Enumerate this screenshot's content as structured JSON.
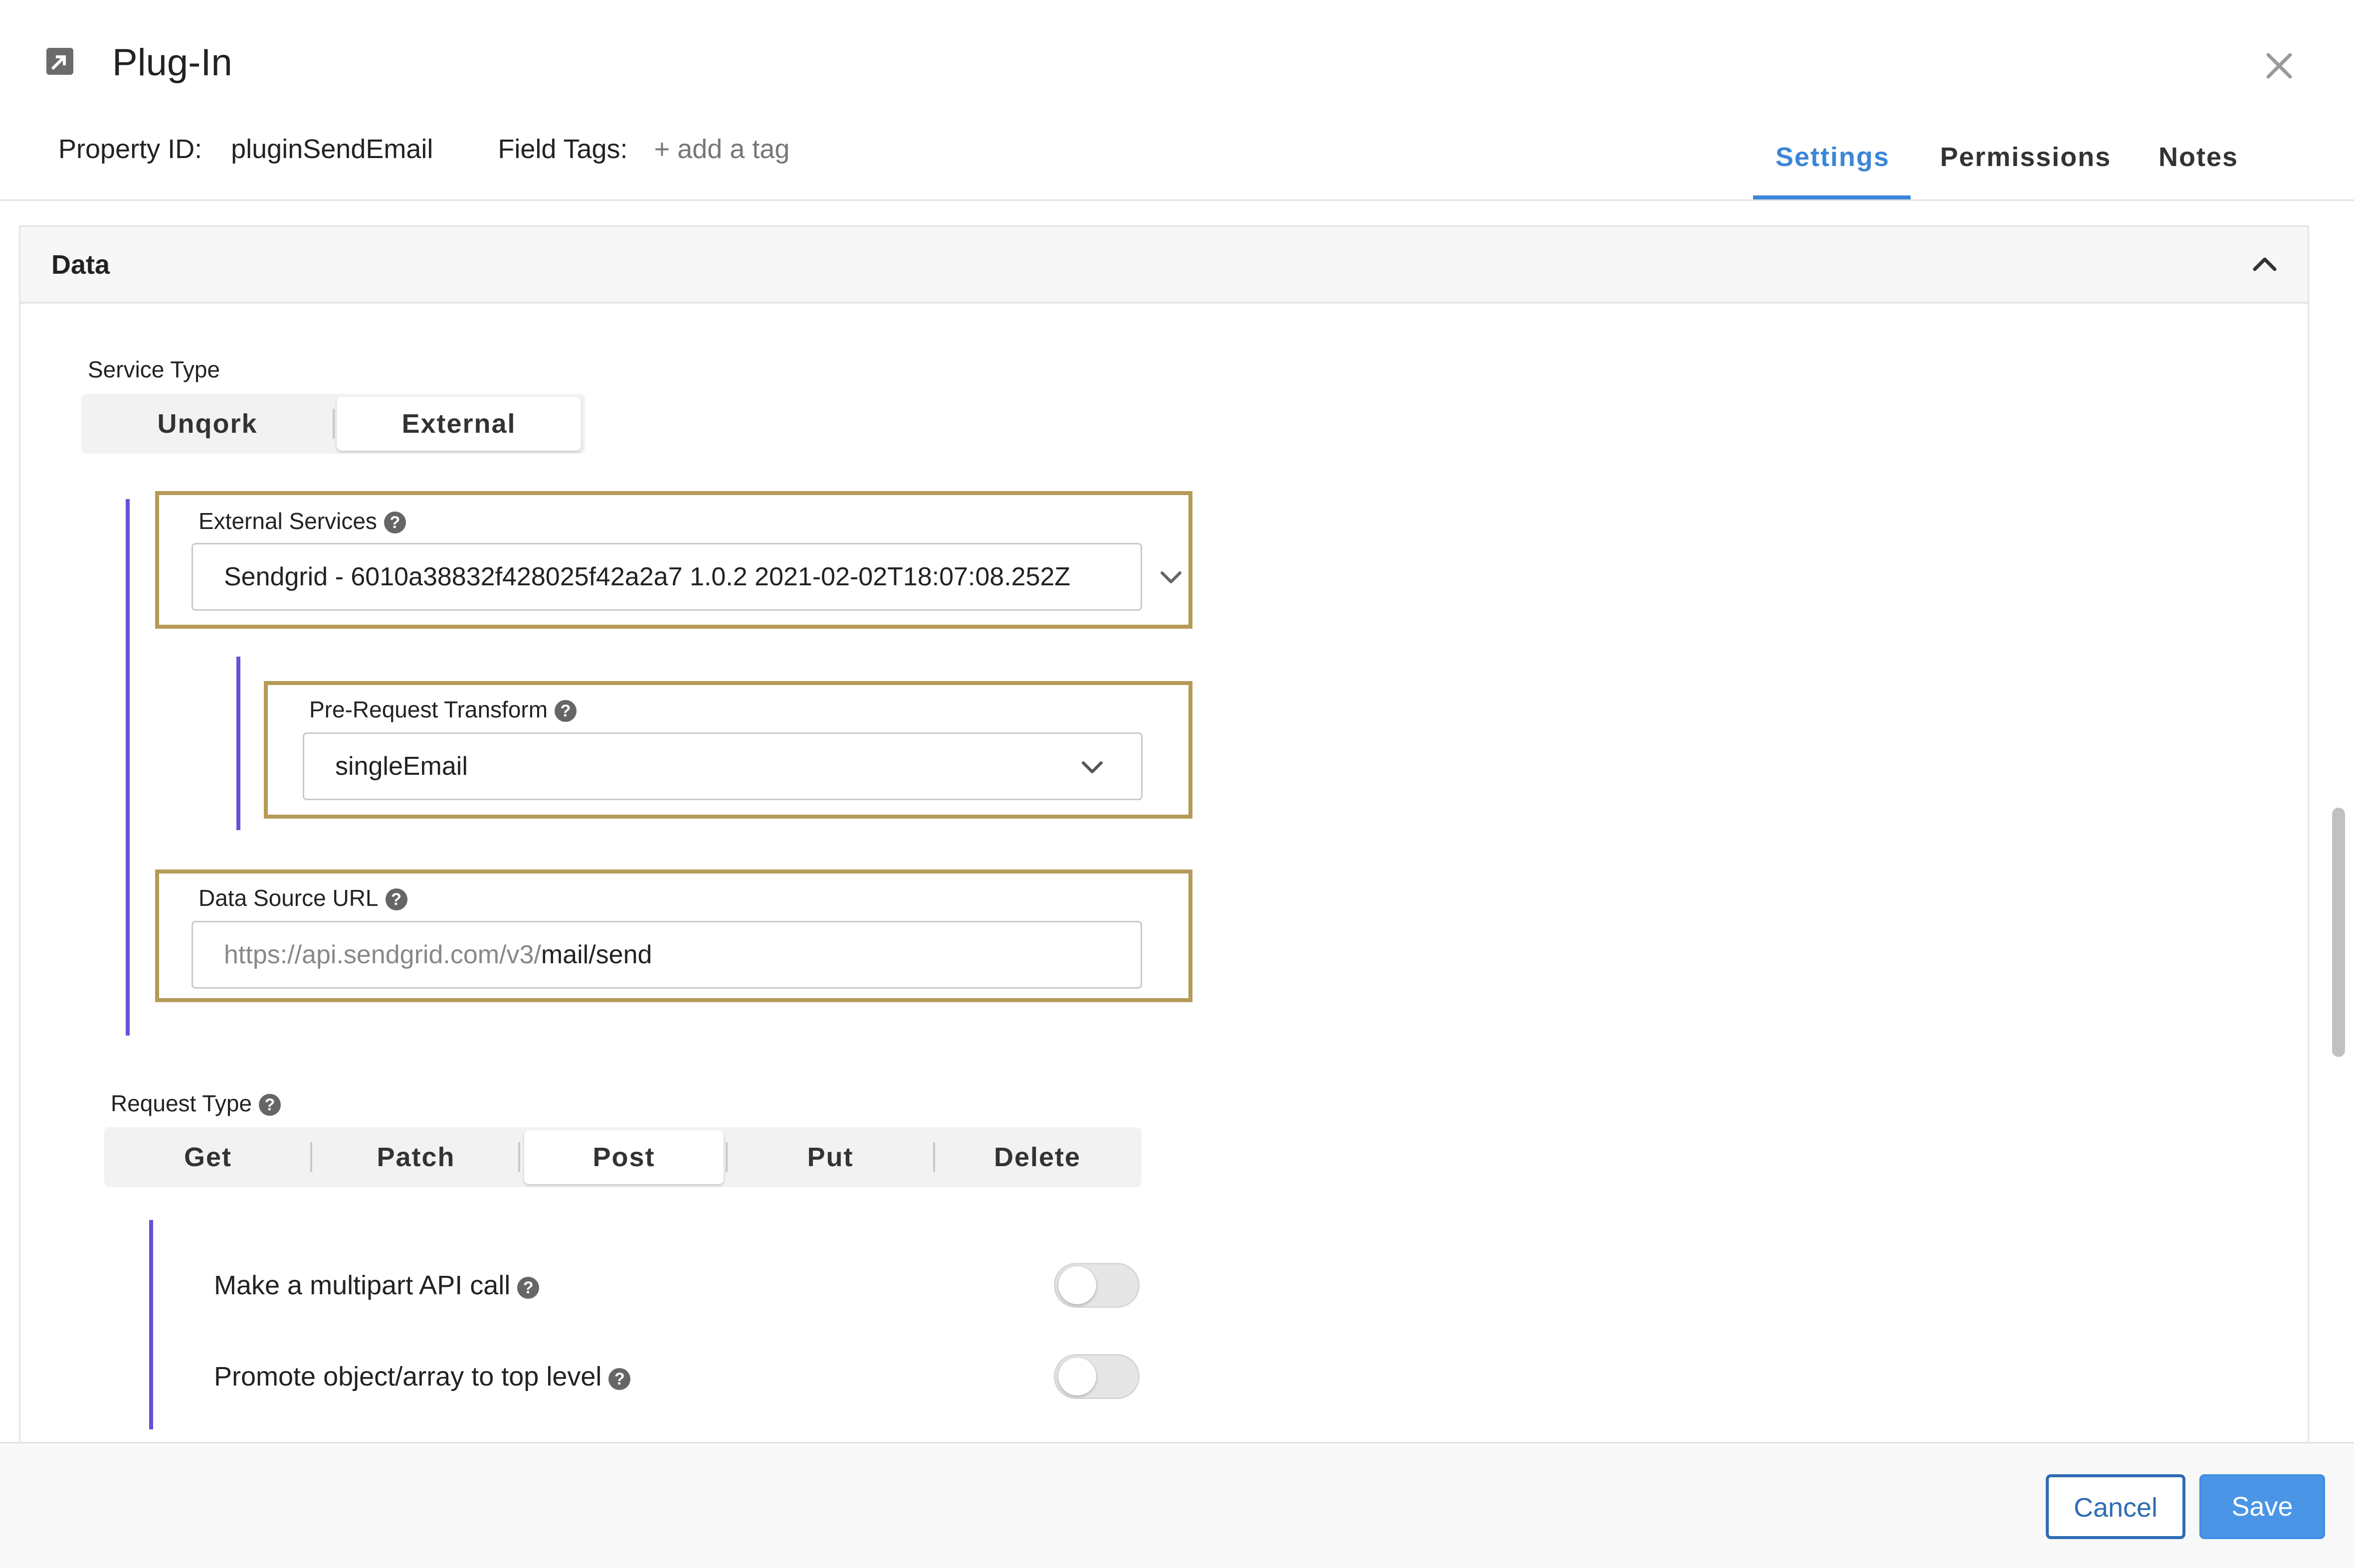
{
  "header": {
    "title": "Plug-In",
    "property_id_label": "Property ID:",
    "property_id_value": "pluginSendEmail",
    "field_tags_label": "Field Tags:",
    "add_tag": "+ add a tag",
    "tabs": [
      {
        "label": "Settings",
        "active": true
      },
      {
        "label": "Permissions",
        "active": false
      },
      {
        "label": "Notes",
        "active": false
      }
    ]
  },
  "panel": {
    "title": "Data",
    "service_type": {
      "label": "Service Type",
      "options": [
        "Unqork",
        "External"
      ],
      "selected": "External"
    },
    "external_services": {
      "label": "External Services",
      "value": "Sendgrid - 6010a38832f428025f42a2a7 1.0.2 2021-02-02T18:07:08.252Z"
    },
    "pre_request_transform": {
      "label": "Pre-Request Transform",
      "value": "singleEmail"
    },
    "data_source_url": {
      "label": "Data Source URL",
      "prefix": "https://api.sendgrid.com/v3/",
      "value": "mail/send"
    },
    "request_type": {
      "label": "Request Type",
      "options": [
        "Get",
        "Patch",
        "Post",
        "Put",
        "Delete"
      ],
      "selected": "Post"
    },
    "toggles": [
      {
        "label": "Make a multipart API call",
        "on": false
      },
      {
        "label": "Promote object/array to top level",
        "on": false
      }
    ]
  },
  "footer": {
    "cancel_label": "Cancel",
    "save_label": "Save"
  },
  "colors": {
    "accent": "#3b86d8",
    "highlight_border": "#b59a58",
    "guide_bar": "#6a4fd8"
  }
}
